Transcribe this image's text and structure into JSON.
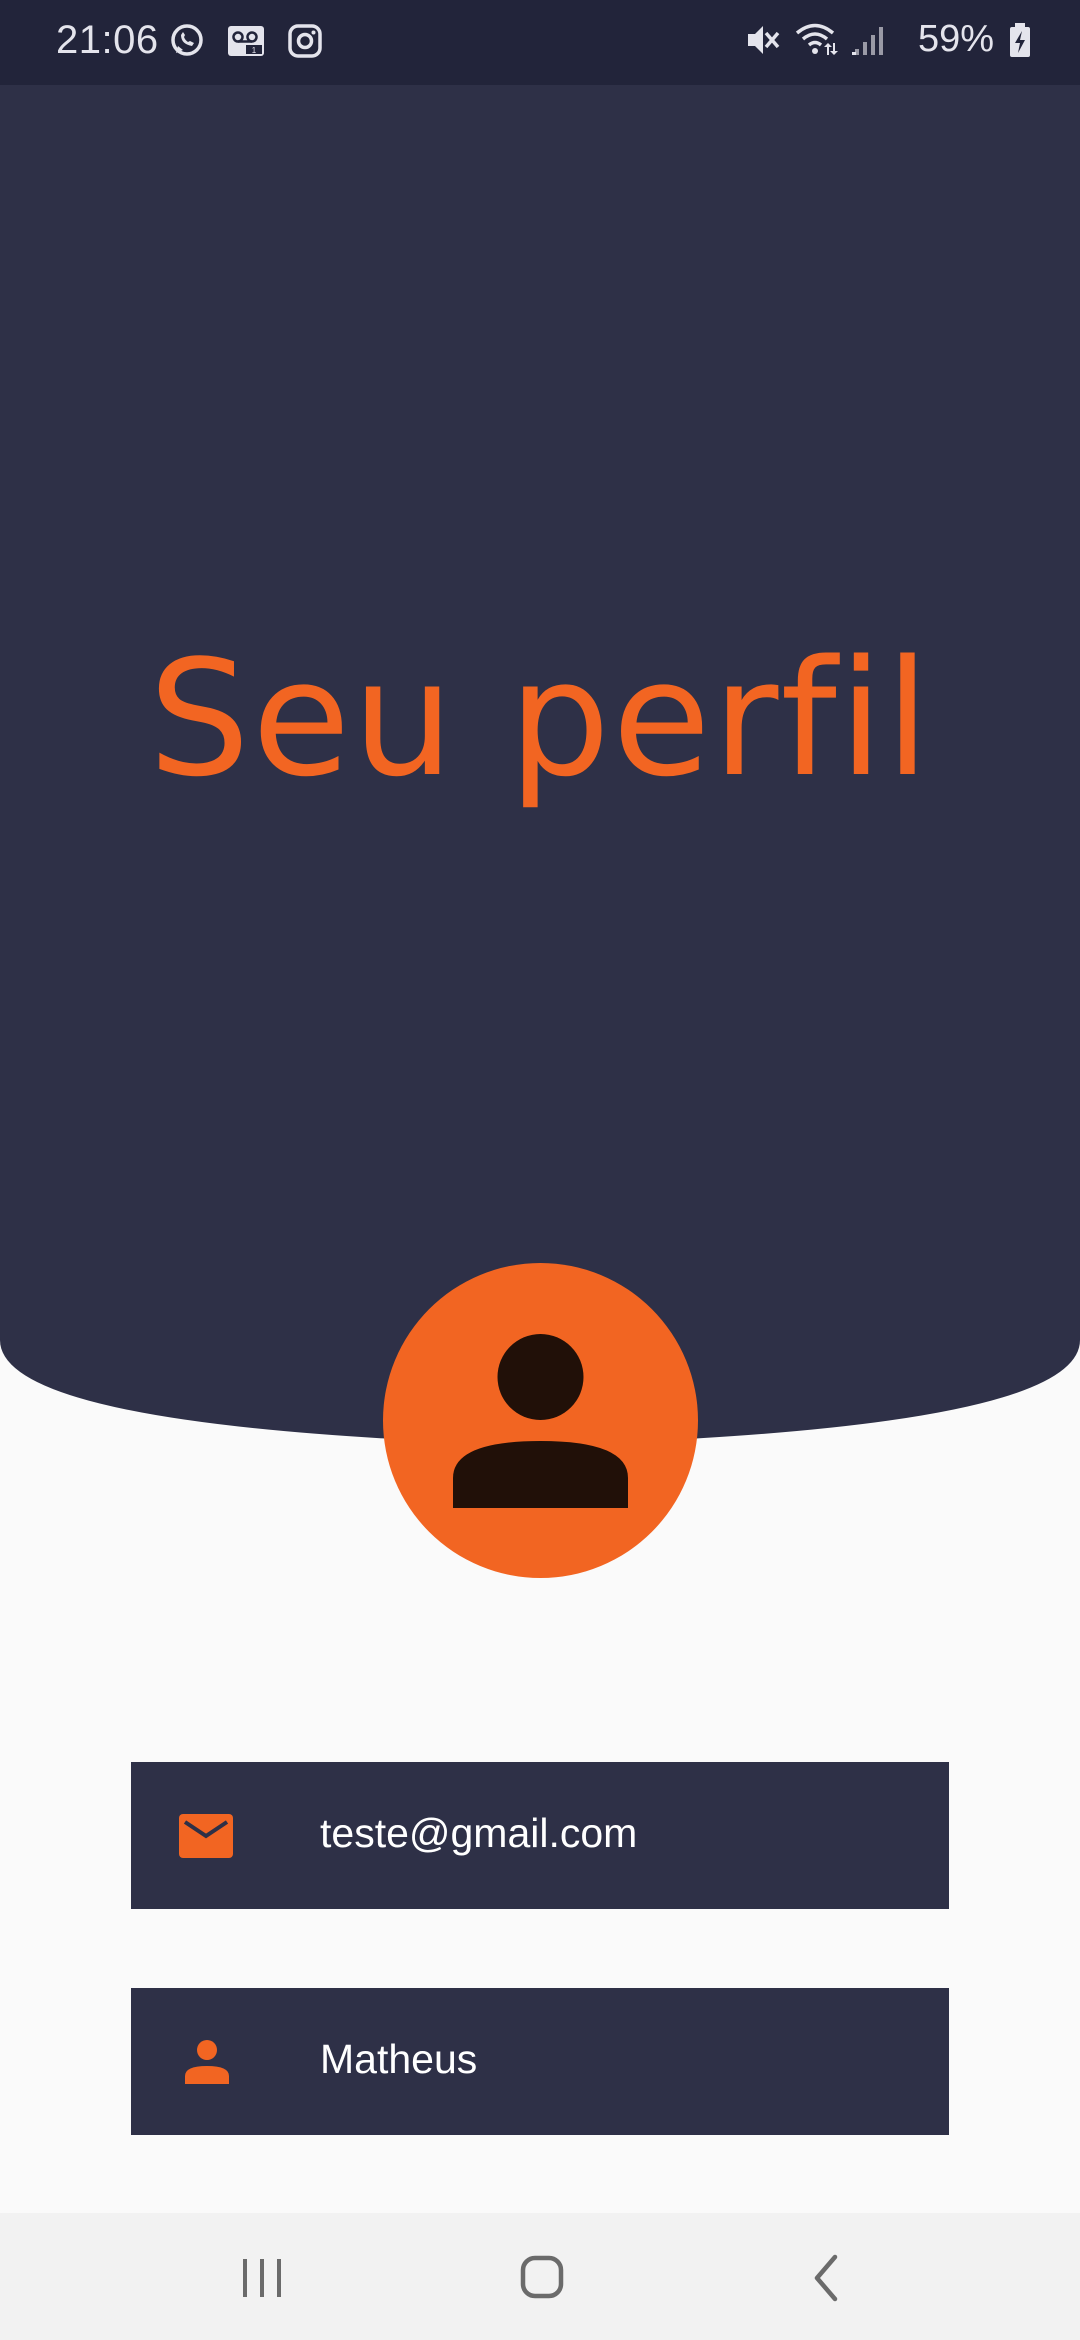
{
  "status_bar": {
    "time": "21:06",
    "battery": "59%",
    "left_icons": [
      "whatsapp-icon",
      "voicemail-icon",
      "instagram-icon"
    ],
    "right_icons": [
      "mute-icon",
      "wifi-icon",
      "signal-icon",
      "battery-charging-icon"
    ]
  },
  "header": {
    "title": "Seu perfil",
    "background_color": "#2e3047",
    "accent_color": "#f26522"
  },
  "avatar": {
    "icon": "person-icon",
    "background_color": "#f26522",
    "figure_color": "#211008"
  },
  "profile": {
    "email": {
      "icon": "email-icon",
      "value": "teste@gmail.com"
    },
    "name": {
      "icon": "person-icon",
      "value": "Matheus"
    }
  },
  "nav_bar": {
    "buttons": [
      "recents-icon",
      "home-icon",
      "back-icon"
    ]
  }
}
